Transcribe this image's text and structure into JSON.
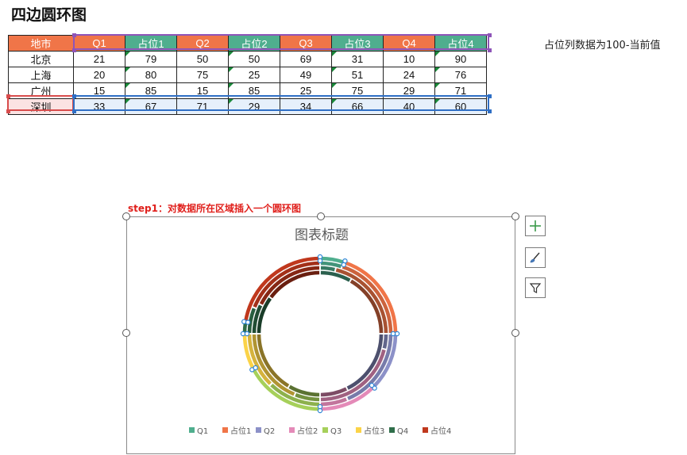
{
  "page": {
    "title": "四边圆环图",
    "note": "占位列数据为100-当前值",
    "step": "step1：对数据所在区域插入一个圆环图"
  },
  "table": {
    "headers": [
      "地市",
      "Q1",
      "占位1",
      "Q2",
      "占位2",
      "Q3",
      "占位3",
      "Q4",
      "占位4"
    ],
    "header_colors": [
      "#f07548",
      "#f07548",
      "#4fae8e",
      "#f07548",
      "#4fae8e",
      "#f07548",
      "#4fae8e",
      "#f07548",
      "#4fae8e"
    ],
    "rows": [
      {
        "city": "北京",
        "values": [
          "21",
          "79",
          "50",
          "50",
          "69",
          "31",
          "10",
          "90"
        ]
      },
      {
        "city": "上海",
        "values": [
          "20",
          "80",
          "75",
          "25",
          "49",
          "51",
          "24",
          "76"
        ]
      },
      {
        "city": "广州",
        "values": [
          "15",
          "85",
          "15",
          "85",
          "25",
          "75",
          "29",
          "71"
        ]
      },
      {
        "city": "深圳",
        "values": [
          "33",
          "67",
          "71",
          "29",
          "34",
          "66",
          "40",
          "60"
        ]
      }
    ]
  },
  "chart": {
    "title": "图表标题",
    "legend": [
      "Q1",
      "占位1",
      "Q2",
      "占位2",
      "Q3",
      "占位3",
      "Q4",
      "占位4"
    ],
    "segment_colors": [
      "#4fae8e",
      "#f07548",
      "#8c91c8",
      "#e48ab8",
      "#a6d05a",
      "#fbd348",
      "#2f6e4a",
      "#c0381d"
    ],
    "ring_shades": [
      0.0,
      0.15,
      0.3,
      0.45
    ]
  },
  "chart_data": {
    "type": "doughnut",
    "title": "图表标题",
    "categories": [
      "Q1",
      "占位1",
      "Q2",
      "占位2",
      "Q3",
      "占位3",
      "Q4",
      "占位4"
    ],
    "series": [
      {
        "name": "北京",
        "values": [
          21,
          79,
          50,
          50,
          69,
          31,
          10,
          90
        ]
      },
      {
        "name": "上海",
        "values": [
          20,
          80,
          75,
          25,
          49,
          51,
          24,
          76
        ]
      },
      {
        "name": "广州",
        "values": [
          15,
          85,
          15,
          85,
          25,
          75,
          29,
          71
        ]
      },
      {
        "name": "深圳",
        "values": [
          33,
          67,
          71,
          29,
          34,
          66,
          40,
          60
        ]
      }
    ]
  }
}
